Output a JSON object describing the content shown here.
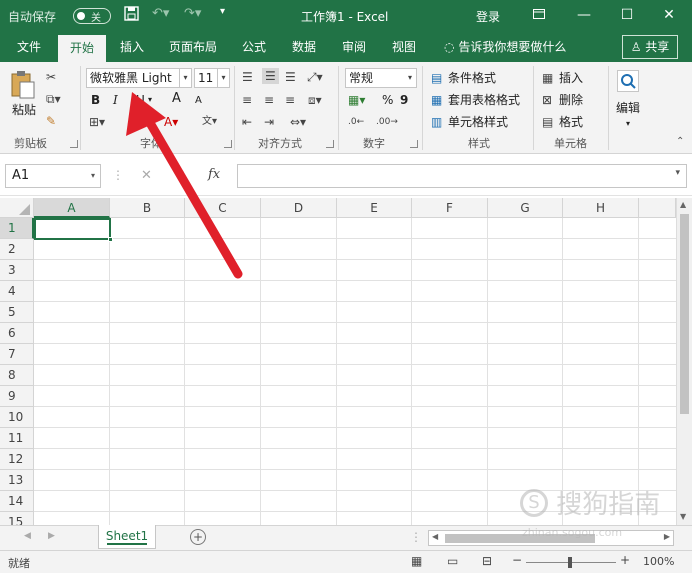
{
  "titlebar": {
    "autosave_label": "自动保存",
    "autosave_state": "关",
    "title": "工作簿1 - Excel",
    "login": "登录"
  },
  "tabs": [
    "文件",
    "开始",
    "插入",
    "页面布局",
    "公式",
    "数据",
    "审阅",
    "视图"
  ],
  "tellme": "告诉我你想要做什么",
  "share": "共享",
  "ribbon": {
    "clipboard": {
      "paste": "粘贴",
      "group": "剪贴板"
    },
    "font": {
      "name": "微软雅黑 Light",
      "size": "11",
      "bold": "B",
      "italic": "I",
      "grow": "A",
      "shrink": "A",
      "group": "字体"
    },
    "alignment": {
      "group": "对齐方式"
    },
    "number": {
      "format": "常规",
      "percent": "%",
      "comma": "9",
      "group": "数字"
    },
    "styles": {
      "conditional": "条件格式",
      "table": "套用表格格式",
      "cell": "单元格样式",
      "group": "样式"
    },
    "cells": {
      "insert": "插入",
      "delete": "删除",
      "format": "格式",
      "group": "单元格"
    },
    "editing": {
      "label": "编辑"
    }
  },
  "formula_bar": {
    "namebox": "A1",
    "fx": "fx",
    "cancel": "✕",
    "enter": "✓"
  },
  "grid": {
    "columns": [
      "A",
      "B",
      "C",
      "D",
      "E",
      "F",
      "G",
      "H"
    ],
    "rows": [
      "1",
      "2",
      "3",
      "4",
      "5",
      "6",
      "7",
      "8",
      "9",
      "10",
      "11",
      "12",
      "13",
      "14",
      "15"
    ]
  },
  "sheet": {
    "name": "Sheet1",
    "add": "+"
  },
  "status": {
    "ready": "就绪",
    "zoom": "100%",
    "minus": "−",
    "plus": "+"
  },
  "watermark": "搜狗指南",
  "watermark_sub": "zhinan.sogou.com",
  "colors": {
    "brand": "#217346",
    "arrow": "#e0202a"
  }
}
